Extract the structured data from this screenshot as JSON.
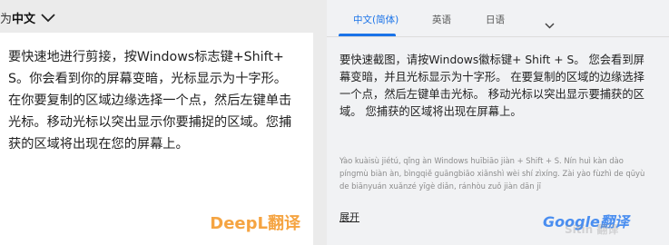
{
  "deepl": {
    "lang_prefix": "为",
    "lang_selected": "中文",
    "translation": "要快速地进行剪接，按Windows标志键+Shift+S。你会看到你的屏幕变暗，光标显示为十字形。在你要复制的区域边缘选择一个点，然后左键单击光标。移动光标以突出显示你要捕捉的区域。您捕获的区域将出现在您的屏幕上。",
    "brand": "DeepL翻译"
  },
  "google": {
    "tabs": [
      {
        "label": "中文(简体)",
        "active": true
      },
      {
        "label": "英语",
        "active": false
      },
      {
        "label": "日语",
        "active": false
      }
    ],
    "translation": "要快速截图，请按Windows徽标键+ Shift + S。 您会看到屏幕变暗，并且光标显示为十字形。 在要复制的区域的边缘选择一个点，然后左键单击光标。 移动光标以突出显示要捕获的区域。 您捕获的区域将出现在屏幕上。",
    "pinyin": "Yào kuàisù jiétú, qǐng àn Windows huībiāo jiàn + Shift + S. Nín huì kàn dào píngmù biàn àn, bìngqiě guāngbiāo xiǎnshì wèi shí zìxíng. Zài yào fùzhì de qūyù de biānyuán xuǎnzé yīgè diǎn, ránhòu zuǒ jiàn dān jī",
    "expand_label": "展开",
    "brand": "Google翻译"
  },
  "watermark": "Sitin 翻译",
  "colors": {
    "deepl_accent": "#f5a442",
    "google_accent": "#1a73e8"
  }
}
